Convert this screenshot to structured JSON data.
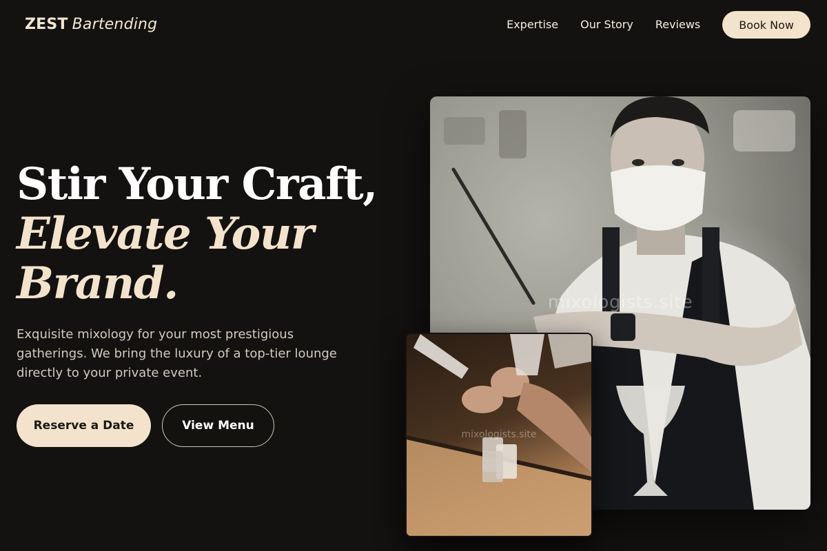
{
  "brand": {
    "name_strong": "ZEST",
    "name_italic": "Bartending"
  },
  "nav": {
    "links": [
      "Expertise",
      "Our Story",
      "Reviews"
    ],
    "cta_label": "Book Now"
  },
  "hero": {
    "headline_line1": "Stir Your Craft,",
    "headline_line2a": "Elevate Your",
    "headline_line2b": "Brand.",
    "subtext": "Exquisite mixology for your most prestigious gatherings. We bring the luxury of a top-tier lounge directly to your private event.",
    "primary_cta": "Reserve a Date",
    "secondary_cta": "View Menu"
  },
  "images": {
    "main_watermark": "mixologists.site",
    "small_watermark": "mixologists.site"
  },
  "colors": {
    "background": "#141210",
    "accent": "#f3e3cc",
    "text": "#f5efe6",
    "muted_text": "#d3cbc0"
  }
}
